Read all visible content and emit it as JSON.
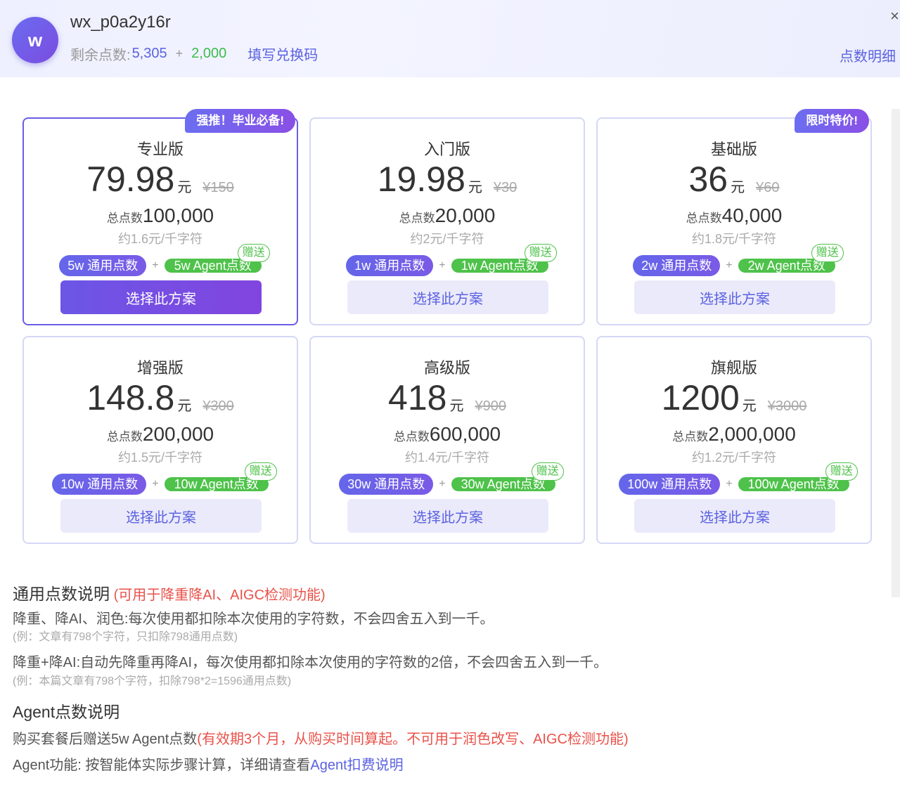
{
  "user": {
    "avatar_letter": "w",
    "name": "wx_p0a2y16r",
    "points_label": "剩余点数:",
    "points_main": "5,305",
    "points_plus": "+",
    "points_bonus": "2,000",
    "redeem_label": "填写兑换码",
    "detail_label": "点数明细",
    "close_label": "×"
  },
  "plans": [
    {
      "tag": "强推！毕业必备!",
      "name": "专业版",
      "price": "79.98",
      "unit": "元",
      "orig": "¥150",
      "total_label": "总点数",
      "total": "100,000",
      "rate": "约1.6元/千字符",
      "general": "5w 通用点数",
      "agent": "5w Agent点数",
      "gift": "赠送",
      "button": "选择此方案",
      "selected": true
    },
    {
      "tag": "",
      "name": "入门版",
      "price": "19.98",
      "unit": "元",
      "orig": "¥30",
      "total_label": "总点数",
      "total": "20,000",
      "rate": "约2元/千字符",
      "general": "1w 通用点数",
      "agent": "1w Agent点数",
      "gift": "赠送",
      "button": "选择此方案",
      "selected": false
    },
    {
      "tag": "限时特价!",
      "name": "基础版",
      "price": "36",
      "unit": "元",
      "orig": "¥60",
      "total_label": "总点数",
      "total": "40,000",
      "rate": "约1.8元/千字符",
      "general": "2w 通用点数",
      "agent": "2w Agent点数",
      "gift": "赠送",
      "button": "选择此方案",
      "selected": false
    },
    {
      "tag": "",
      "name": "增强版",
      "price": "148.8",
      "unit": "元",
      "orig": "¥300",
      "total_label": "总点数",
      "total": "200,000",
      "rate": "约1.5元/千字符",
      "general": "10w 通用点数",
      "agent": "10w Agent点数",
      "gift": "赠送",
      "button": "选择此方案",
      "selected": false
    },
    {
      "tag": "",
      "name": "高级版",
      "price": "418",
      "unit": "元",
      "orig": "¥900",
      "total_label": "总点数",
      "total": "600,000",
      "rate": "约1.4元/千字符",
      "general": "30w 通用点数",
      "agent": "30w Agent点数",
      "gift": "赠送",
      "button": "选择此方案",
      "selected": false
    },
    {
      "tag": "",
      "name": "旗舰版",
      "price": "1200",
      "unit": "元",
      "orig": "¥3000",
      "total_label": "总点数",
      "total": "2,000,000",
      "rate": "约1.2元/千字符",
      "general": "100w 通用点数",
      "agent": "100w Agent点数",
      "gift": "赠送",
      "button": "选择此方案",
      "selected": false
    }
  ],
  "plus_sign": "+",
  "explain": {
    "general_title": "通用点数说明",
    "general_note": "(可用于降重降AI、AIGC检测功能)",
    "line1": "降重、降AI、润色:每次使用都扣除本次使用的字符数，不会四舍五入到一千。",
    "line1_example": "(例：文章有798个字符，只扣除798通用点数)",
    "line2": "降重+降AI:自动先降重再降AI，每次使用都扣除本次使用的字符数的2倍，不会四舍五入到一千。",
    "line2_example": "(例：本篇文章有798个字符，扣除798*2=1596通用点数)",
    "agent_title": "Agent点数说明",
    "agent_line1": "购买套餐后赠送5w Agent点数",
    "agent_line1_note": "(有效期3个月，从购买时间算起。不可用于润色改写、AIGC检测功能)",
    "agent_line2": "Agent功能: 按智能体实际步骤计算，详细请查看",
    "agent_link": "Agent扣费说明"
  }
}
